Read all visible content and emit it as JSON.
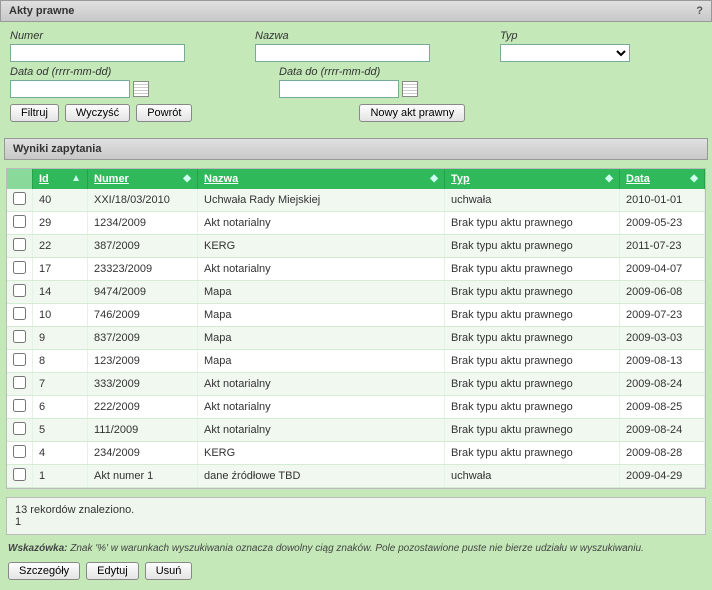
{
  "window": {
    "title": "Akty prawne",
    "help": "?"
  },
  "filters": {
    "numer_label": "Numer",
    "nazwa_label": "Nazwa",
    "typ_label": "Typ",
    "data_od_label": "Data od (rrrr-mm-dd)",
    "data_do_label": "Data do (rrrr-mm-dd)",
    "numer_val": "",
    "nazwa_val": "",
    "typ_val": "",
    "data_od_val": "",
    "data_do_val": ""
  },
  "buttons": {
    "filtruj": "Filtruj",
    "wyczysc": "Wyczyść",
    "powrot": "Powrót",
    "nowy": "Nowy akt prawny",
    "szczegoly": "Szczegóły",
    "edytuj": "Edytuj",
    "usun": "Usuń"
  },
  "results_header": "Wyniki zapytania",
  "columns": {
    "id": "Id",
    "numer": "Numer",
    "nazwa": "Nazwa",
    "typ": "Typ",
    "data": "Data"
  },
  "rows": [
    {
      "id": "40",
      "numer": "XXI/18/03/2010",
      "nazwa": "Uchwała Rady Miejskiej",
      "typ": "uchwała",
      "data": "2010-01-01"
    },
    {
      "id": "29",
      "numer": "1234/2009",
      "nazwa": "Akt notarialny",
      "typ": "Brak typu aktu prawnego",
      "data": "2009-05-23"
    },
    {
      "id": "22",
      "numer": "387/2009",
      "nazwa": "KERG",
      "typ": "Brak typu aktu prawnego",
      "data": "2011-07-23"
    },
    {
      "id": "17",
      "numer": "23323/2009",
      "nazwa": "Akt notarialny",
      "typ": "Brak typu aktu prawnego",
      "data": "2009-04-07"
    },
    {
      "id": "14",
      "numer": "9474/2009",
      "nazwa": "Mapa",
      "typ": "Brak typu aktu prawnego",
      "data": "2009-06-08"
    },
    {
      "id": "10",
      "numer": "746/2009",
      "nazwa": "Mapa",
      "typ": "Brak typu aktu prawnego",
      "data": "2009-07-23"
    },
    {
      "id": "9",
      "numer": "837/2009",
      "nazwa": "Mapa",
      "typ": "Brak typu aktu prawnego",
      "data": "2009-03-03"
    },
    {
      "id": "8",
      "numer": "123/2009",
      "nazwa": "Mapa",
      "typ": "Brak typu aktu prawnego",
      "data": "2009-08-13"
    },
    {
      "id": "7",
      "numer": "333/2009",
      "nazwa": "Akt notarialny",
      "typ": "Brak typu aktu prawnego",
      "data": "2009-08-24"
    },
    {
      "id": "6",
      "numer": "222/2009",
      "nazwa": "Akt notarialny",
      "typ": "Brak typu aktu prawnego",
      "data": "2009-08-25"
    },
    {
      "id": "5",
      "numer": "111/2009",
      "nazwa": "Akt notarialny",
      "typ": "Brak typu aktu prawnego",
      "data": "2009-08-24"
    },
    {
      "id": "4",
      "numer": "234/2009",
      "nazwa": "KERG",
      "typ": "Brak typu aktu prawnego",
      "data": "2009-08-28"
    },
    {
      "id": "1",
      "numer": "Akt numer 1",
      "nazwa": "dane źródłowe TBD",
      "typ": "uchwała",
      "data": "2009-04-29"
    }
  ],
  "footer": {
    "count_text": "13 rekordów znaleziono.",
    "page": "1"
  },
  "hint_label": "Wskazówka:",
  "hint_text": " Znak '%' w warunkach wyszukiwania oznacza dowolny ciąg znaków. Pole pozostawione puste nie bierze udziału w wyszukiwaniu."
}
